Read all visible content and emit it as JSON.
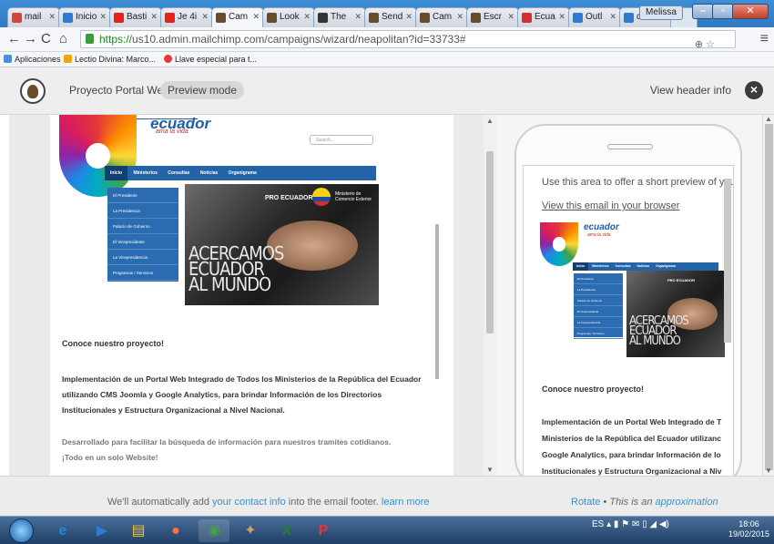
{
  "browser": {
    "tabs": [
      {
        "label": "mail",
        "color": "#d44638"
      },
      {
        "label": "Inicio",
        "color": "#2e7bd1"
      },
      {
        "label": "Basti",
        "color": "#e62117"
      },
      {
        "label": "Je 4i",
        "color": "#e62117"
      },
      {
        "label": "Cam",
        "color": "#6b4a2a"
      },
      {
        "label": "Look",
        "color": "#6b4a2a"
      },
      {
        "label": "The",
        "color": "#333333"
      },
      {
        "label": "Send",
        "color": "#6b4a2a"
      },
      {
        "label": "Cam",
        "color": "#6b4a2a"
      },
      {
        "label": "Escr",
        "color": "#6b4a2a"
      },
      {
        "label": "Ecua",
        "color": "#d32f2f"
      },
      {
        "label": "Outl",
        "color": "#2e7bd1"
      },
      {
        "label": "carn",
        "color": "#2e7bd1"
      }
    ],
    "active_tab_index": 4,
    "user_name": "Melissa",
    "url_scheme": "https://",
    "url_rest": "us10.admin.mailchimp.com/campaigns/wizard/neapolitan?id=33733#",
    "bookmarks": [
      {
        "label": "Aplicaciones",
        "color": "#4a90d9"
      },
      {
        "label": "Lectio Divina: Marco...",
        "color": "#f0a30a"
      },
      {
        "label": "Llave especial para t...",
        "color": "#e53935"
      }
    ]
  },
  "mailchimp": {
    "project_name": "Proyecto Portal Web",
    "mode_badge": "Preview mode",
    "view_header": "View header info"
  },
  "email": {
    "site_title": "ecuador",
    "site_tagline": "ama la vida",
    "search_placeholder": "Search...",
    "nav": [
      "Inicio",
      "Ministerios",
      "Consultas",
      "Noticias",
      "Organigrama"
    ],
    "side_menu": [
      "El Presidente",
      "La Presidencia",
      "Palacio de Gobierno",
      "El Vicepresidente",
      "La Vicepresidencia",
      "Programas / Servicios"
    ],
    "banner_org": "PRO ECUADOR",
    "banner_ministry": "Ministerio de Comercio Exterior",
    "banner_words": [
      "ACERCAMOS",
      "ECUADOR",
      "AL MUNDO"
    ],
    "heading": "Conoce nuestro proyecto!",
    "paragraph1": "Implementación de un Portal Web Integrado de Todos los Ministerios de la República del Ecuador utilizando CMS Joomla y Google Analytics, para brindar Información de los Directorios Institucionales y Estructura Organizacional a Nivel Nacional.",
    "paragraph2_line1": "Desarrollado para facilitar la búsqueda de información para  nuestros tramites cotidianos.",
    "paragraph2_line2": "¡Todo en un solo Website!"
  },
  "mobile": {
    "preheader": "Use this area to offer a short preview of your",
    "view_in_browser": "View this email in your browser",
    "heading": "Conoce nuestro proyecto!",
    "paragraph_lines": [
      "Implementación de un Portal Web Integrado de T",
      "Ministerios de la República del Ecuador utilizanc",
      "Google Analytics, para brindar Información de lo",
      "Institucionales y Estructura Organizacional a Niv"
    ]
  },
  "footer": {
    "left_prefix": "We'll automatically add ",
    "left_link": "your contact info",
    "left_middle": " into the email footer. ",
    "left_link2": "learn more",
    "rotate": "Rotate",
    "separator": " • ",
    "approx_prefix": "This is an ",
    "approx_link": "approximation"
  },
  "taskbar": {
    "language": "ES",
    "time": "18:06",
    "date": "19/02/2015"
  },
  "colors": {
    "accent_link": "#3a8fc9",
    "nav_blue": "#2463a6",
    "title_blue": "#1f5fa8"
  }
}
